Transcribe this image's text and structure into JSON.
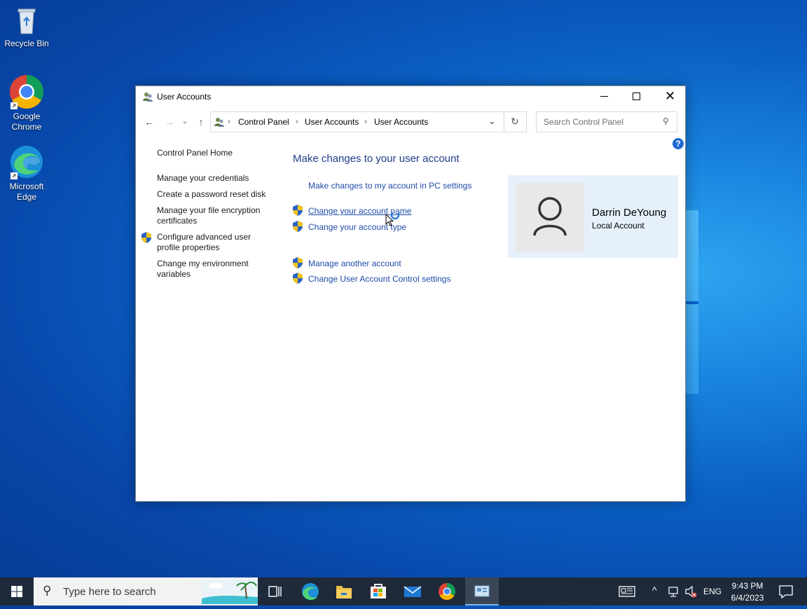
{
  "desktop": {
    "icons": [
      {
        "label": "Recycle Bin"
      },
      {
        "label": "Google Chrome"
      },
      {
        "label": "Microsoft Edge"
      }
    ]
  },
  "window": {
    "title": "User Accounts",
    "breadcrumb": [
      "Control Panel",
      "User Accounts",
      "User Accounts"
    ],
    "search_placeholder": "Search Control Panel"
  },
  "sidebar": {
    "home": "Control Panel Home",
    "items": [
      "Manage your credentials",
      "Create a password reset disk",
      "Manage your file encryption certificates",
      "Configure advanced user profile properties",
      "Change my environment variables"
    ]
  },
  "main": {
    "title": "Make changes to your user account",
    "links": [
      "Make changes to my account in PC settings",
      "Change your account name",
      "Change your account type",
      "Manage another account",
      "Change User Account Control settings"
    ]
  },
  "account": {
    "name": "Darrin DeYoung",
    "type": "Local Account"
  },
  "taskbar": {
    "search_placeholder": "Type here to search",
    "language": "ENG",
    "time": "9:43 PM",
    "date": "6/4/2023"
  },
  "colors": {
    "link": "#1f4aa8",
    "title": "#1e3c8c",
    "account_bg": "#e6f0fa",
    "taskbar": "#1e2a3a"
  }
}
